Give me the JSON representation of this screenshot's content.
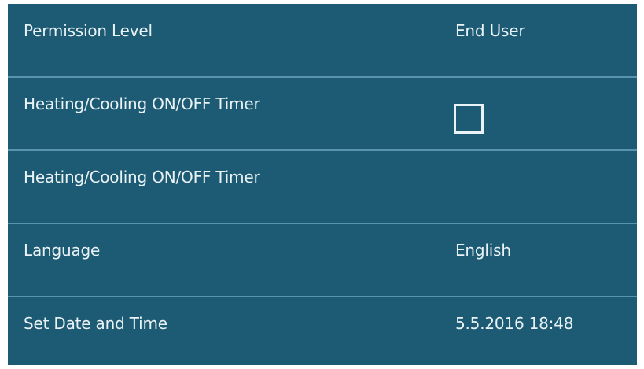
{
  "settings": {
    "rows": [
      {
        "label": "Permission Level",
        "value": "End User"
      },
      {
        "label": "Heating/Cooling ON/OFF Timer",
        "checked": false
      },
      {
        "label": "Heating/Cooling ON/OFF Timer",
        "value": ""
      },
      {
        "label": "Language",
        "value": "English"
      },
      {
        "label": "Set Date and Time",
        "value": "5.5.2016 18:48"
      }
    ]
  },
  "colors": {
    "panel_background": "#1d5a73",
    "divider": "#6ea8c2",
    "text": "#e9f2f5"
  }
}
